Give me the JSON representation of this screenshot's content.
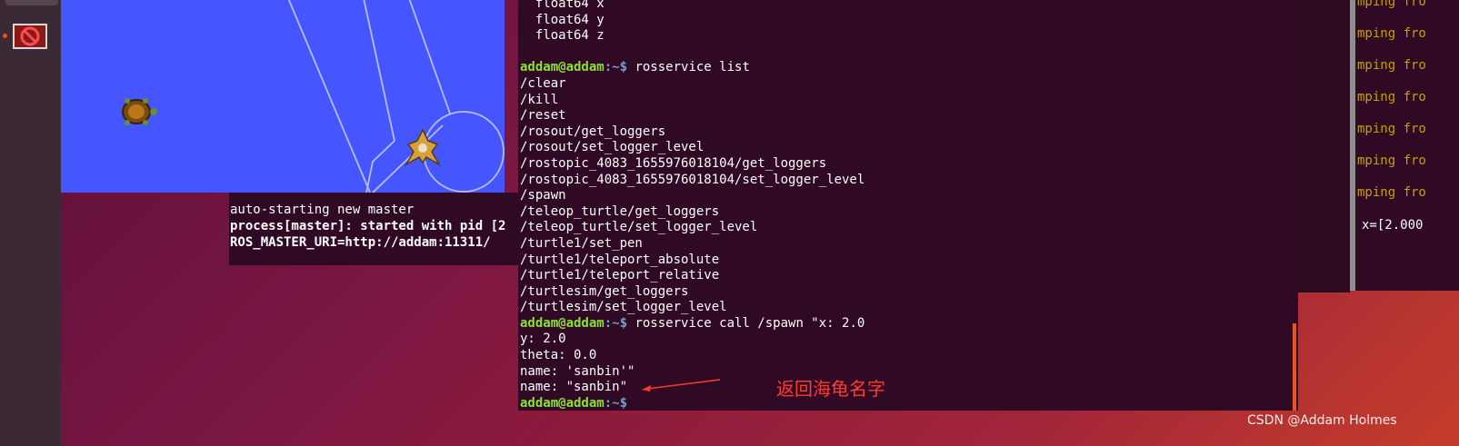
{
  "dock": {
    "blocked_app_icon": "no-entry-icon"
  },
  "turtlesim": {
    "bg_color": "#4556ff",
    "pen_color": "#b3b3ff"
  },
  "roscore_terminal": {
    "lines": [
      "auto-starting new master",
      "process[master]: started with pid [2",
      "ROS_MASTER_URI=http://addam:11311/"
    ]
  },
  "right_terminal": {
    "repeated_text": "mping fro",
    "value_text": "x=[2.000"
  },
  "main_terminal": {
    "prompt_user": "addam@addam",
    "prompt_sep": ":~$ ",
    "top_lines": [
      "  float64 x",
      "  float64 y",
      "  float64 z",
      ""
    ],
    "cmd1": "rosservice list",
    "services": [
      "/clear",
      "/kill",
      "/reset",
      "/rosout/get_loggers",
      "/rosout/set_logger_level",
      "/rostopic_4083_1655976018104/get_loggers",
      "/rostopic_4083_1655976018104/set_logger_level",
      "/spawn",
      "/teleop_turtle/get_loggers",
      "/teleop_turtle/set_logger_level",
      "/turtle1/set_pen",
      "/turtle1/teleport_absolute",
      "/turtle1/teleport_relative",
      "/turtlesim/get_loggers",
      "/turtlesim/set_logger_level"
    ],
    "cmd2": "rosservice call /spawn \"x: 2.0",
    "cmd2_cont": [
      "y: 2.0",
      "theta: 0.0",
      "name: 'sanbin'\""
    ],
    "result": "name: \"sanbin\""
  },
  "annotation": {
    "text": "返回海龟名字",
    "color": "#ff3b30"
  },
  "watermark": "CSDN @Addam Holmes",
  "accent": "#e95420"
}
